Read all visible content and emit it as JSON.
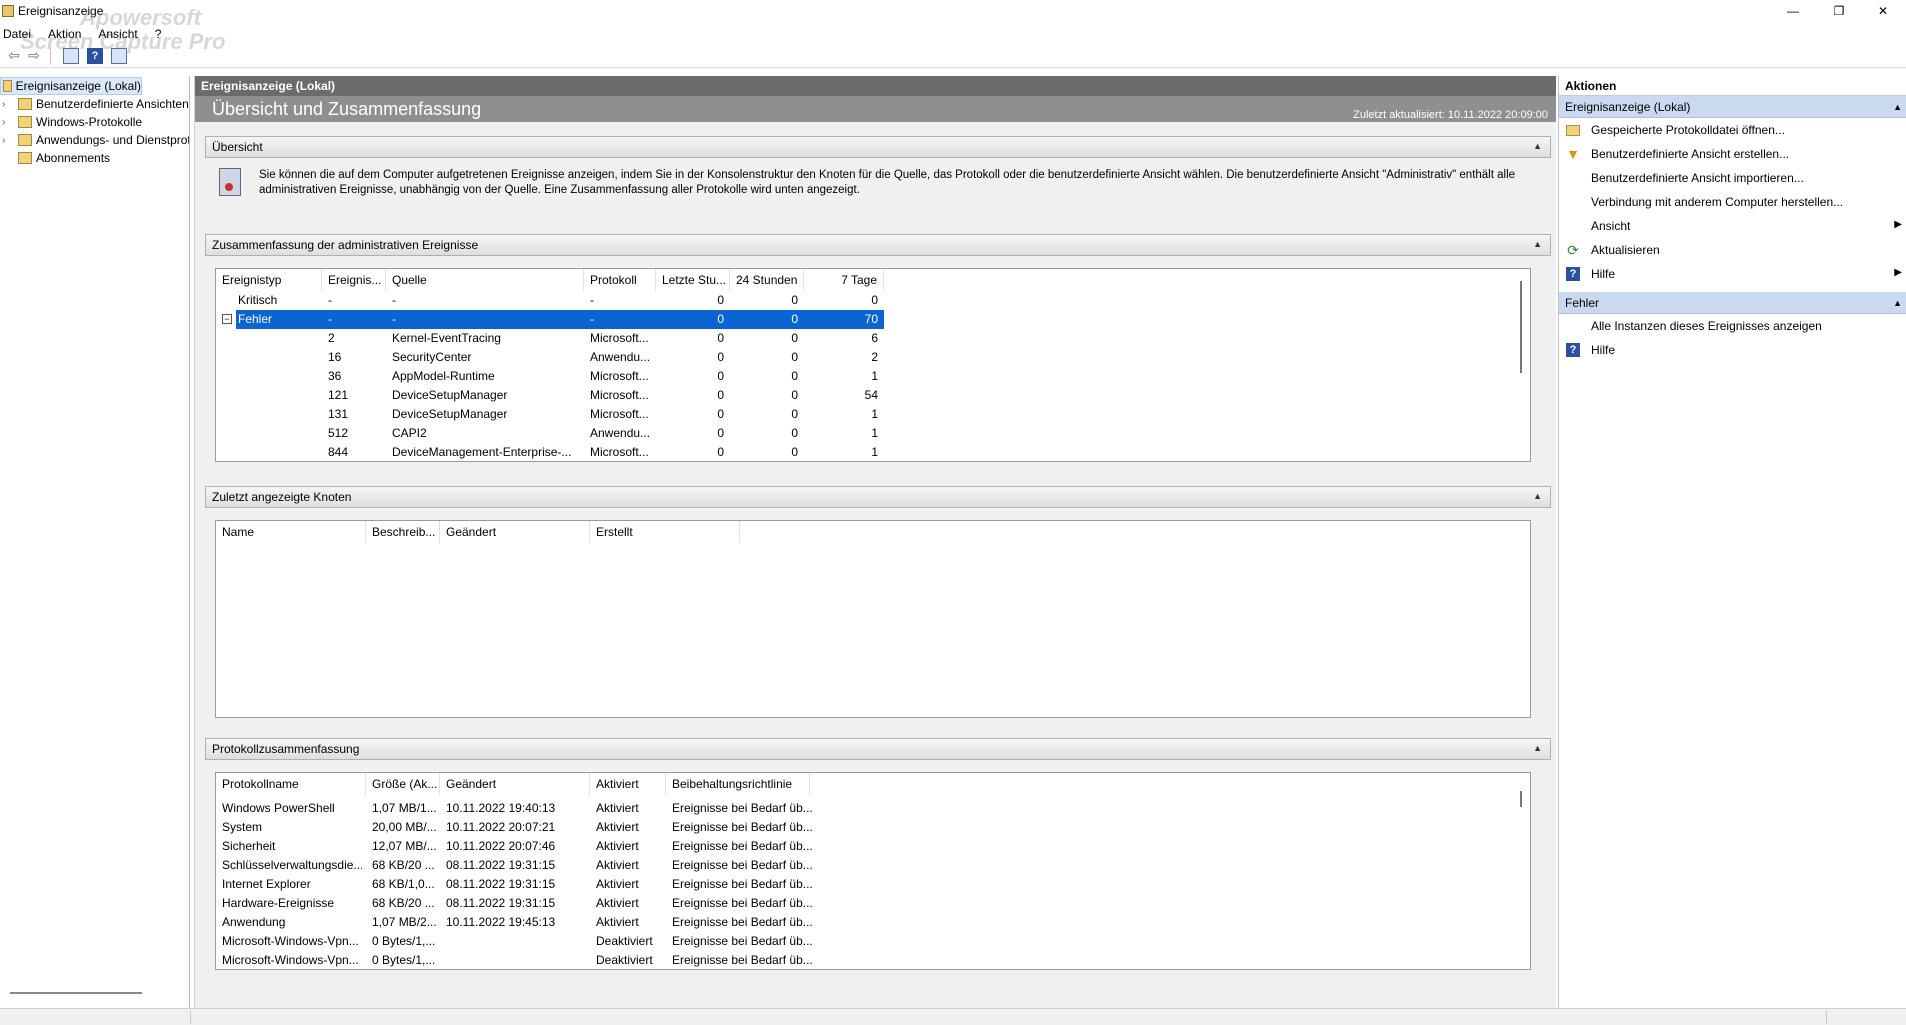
{
  "window": {
    "title": "Ereignisanzeige",
    "minimize": "—",
    "restore": "❐",
    "close": "✕"
  },
  "watermark": {
    "line1": "Apowersoft",
    "line2": "Screen Capture Pro"
  },
  "menu": [
    "Datei",
    "Aktion",
    "Ansicht",
    "?"
  ],
  "tree": {
    "items": [
      {
        "label": "Ereignisanzeige (Lokal)",
        "expander": ""
      },
      {
        "label": "Benutzerdefinierte Ansichten",
        "expander": "›"
      },
      {
        "label": "Windows-Protokolle",
        "expander": "›"
      },
      {
        "label": "Anwendungs- und Dienstprotokolle",
        "expander": "›"
      },
      {
        "label": "Abonnements",
        "expander": ""
      }
    ]
  },
  "center": {
    "header": "Ereignisanzeige (Lokal)",
    "title": "Übersicht und Zusammenfassung",
    "updated": "Zuletzt aktualisiert: 10.11.2022 20:09:00",
    "overview": {
      "label": "Übersicht",
      "text": "Sie können die auf dem Computer aufgetretenen Ereignisse anzeigen, indem Sie in der Konsolenstruktur den Knoten für die Quelle, das Protokoll oder die benutzerdefinierte Ansicht wählen. Die benutzerdefinierte Ansicht \"Administrativ\" enthält alle administrativen Ereignisse, unabhängig von der Quelle. Eine Zusammenfassung aller Protokolle wird unten angezeigt."
    },
    "admin_summary": {
      "label": "Zusammenfassung der administrativen Ereignisse",
      "columns": [
        "Ereignistyp",
        "Ereignis...",
        "Quelle",
        "Protokoll",
        "Letzte Stu...",
        "24 Stunden",
        "7 Tage"
      ],
      "rows": [
        {
          "type": "Kritisch",
          "id": "-",
          "source": "-",
          "log": "-",
          "hour": "0",
          "day": "0",
          "week": "0"
        },
        {
          "type": "Fehler",
          "id": "-",
          "source": "-",
          "log": "-",
          "hour": "0",
          "day": "0",
          "week": "70",
          "selected": true
        },
        {
          "type": "",
          "id": "2",
          "source": "Kernel-EventTracing",
          "log": "Microsoft...",
          "hour": "0",
          "day": "0",
          "week": "6"
        },
        {
          "type": "",
          "id": "16",
          "source": "SecurityCenter",
          "log": "Anwendu...",
          "hour": "0",
          "day": "0",
          "week": "2"
        },
        {
          "type": "",
          "id": "36",
          "source": "AppModel-Runtime",
          "log": "Microsoft...",
          "hour": "0",
          "day": "0",
          "week": "1"
        },
        {
          "type": "",
          "id": "121",
          "source": "DeviceSetupManager",
          "log": "Microsoft...",
          "hour": "0",
          "day": "0",
          "week": "54"
        },
        {
          "type": "",
          "id": "131",
          "source": "DeviceSetupManager",
          "log": "Microsoft...",
          "hour": "0",
          "day": "0",
          "week": "1"
        },
        {
          "type": "",
          "id": "512",
          "source": "CAPI2",
          "log": "Anwendu...",
          "hour": "0",
          "day": "0",
          "week": "1"
        },
        {
          "type": "",
          "id": "844",
          "source": "DeviceManagement-Enterprise-...",
          "log": "Microsoft...",
          "hour": "0",
          "day": "0",
          "week": "1"
        }
      ]
    },
    "recent_nodes": {
      "label": "Zuletzt angezeigte Knoten",
      "columns": [
        "Name",
        "Beschreib...",
        "Geändert",
        "Erstellt"
      ]
    },
    "log_summary": {
      "label": "Protokollzusammenfassung",
      "columns": [
        "Protokollname",
        "Größe (Ak...",
        "Geändert",
        "Aktiviert",
        "Beibehaltungsrichtlinie"
      ],
      "rows": [
        {
          "name": "Windows PowerShell",
          "size": "1,07 MB/1...",
          "changed": "10.11.2022 19:40:13",
          "enabled": "Aktiviert",
          "policy": "Ereignisse bei Bedarf üb..."
        },
        {
          "name": "System",
          "size": "20,00 MB/...",
          "changed": "10.11.2022 20:07:21",
          "enabled": "Aktiviert",
          "policy": "Ereignisse bei Bedarf üb..."
        },
        {
          "name": "Sicherheit",
          "size": "12,07 MB/...",
          "changed": "10.11.2022 20:07:46",
          "enabled": "Aktiviert",
          "policy": "Ereignisse bei Bedarf üb..."
        },
        {
          "name": "Schlüsselverwaltungsdie...",
          "size": "68 KB/20 ...",
          "changed": "08.11.2022 19:31:15",
          "enabled": "Aktiviert",
          "policy": "Ereignisse bei Bedarf üb..."
        },
        {
          "name": "Internet Explorer",
          "size": "68 KB/1,0...",
          "changed": "08.11.2022 19:31:15",
          "enabled": "Aktiviert",
          "policy": "Ereignisse bei Bedarf üb..."
        },
        {
          "name": "Hardware-Ereignisse",
          "size": "68 KB/20 ...",
          "changed": "08.11.2022 19:31:15",
          "enabled": "Aktiviert",
          "policy": "Ereignisse bei Bedarf üb..."
        },
        {
          "name": "Anwendung",
          "size": "1,07 MB/2...",
          "changed": "10.11.2022 19:45:13",
          "enabled": "Aktiviert",
          "policy": "Ereignisse bei Bedarf üb..."
        },
        {
          "name": "Microsoft-Windows-Vpn...",
          "size": "0 Bytes/1,...",
          "changed": "",
          "enabled": "Deaktiviert",
          "policy": "Ereignisse bei Bedarf üb..."
        },
        {
          "name": "Microsoft-Windows-Vpn...",
          "size": "0 Bytes/1,...",
          "changed": "",
          "enabled": "Deaktiviert",
          "policy": "Ereignisse bei Bedarf üb..."
        }
      ]
    }
  },
  "actions": {
    "header": "Aktionen",
    "group1": {
      "label": "Ereignisanzeige (Lokal)",
      "items": [
        {
          "label": "Gespeicherte Protokolldatei öffnen...",
          "icon": "folder-icon"
        },
        {
          "label": "Benutzerdefinierte Ansicht erstellen...",
          "icon": "filter-icon"
        },
        {
          "label": "Benutzerdefinierte Ansicht importieren...",
          "icon": ""
        },
        {
          "label": "Verbindung mit anderem Computer herstellen...",
          "icon": ""
        },
        {
          "label": "Ansicht",
          "icon": "",
          "submenu": true
        },
        {
          "label": "Aktualisieren",
          "icon": "refresh-icon"
        },
        {
          "label": "Hilfe",
          "icon": "help-icon",
          "submenu": true
        }
      ]
    },
    "group2": {
      "label": "Fehler",
      "items": [
        {
          "label": "Alle Instanzen dieses Ereignisses anzeigen",
          "icon": ""
        },
        {
          "label": "Hilfe",
          "icon": "help-icon"
        }
      ]
    }
  }
}
